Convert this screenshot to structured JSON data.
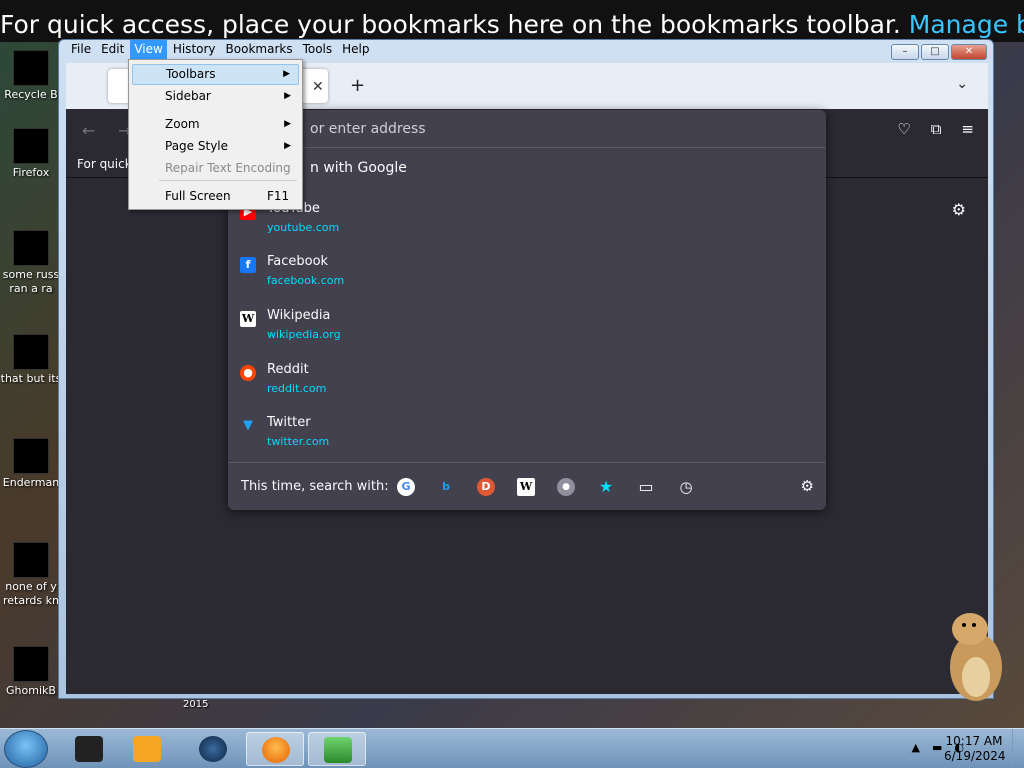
{
  "desktop": {
    "banner_text": "For quick access, place your bookmarks here on the bookmarks toolbar.",
    "banner_link": "Manage book",
    "icons": [
      {
        "label": "Recycle B"
      },
      {
        "label": "Firefox"
      },
      {
        "label": "some russ ran a ra"
      },
      {
        "label": "that but its"
      },
      {
        "label": "Enderman"
      },
      {
        "label": "none of y retards kn"
      },
      {
        "label": "GhomikB"
      }
    ],
    "year_label": "2015"
  },
  "window": {
    "menubar": [
      "File",
      "Edit",
      "View",
      "History",
      "Bookmarks",
      "Tools",
      "Help"
    ],
    "active_menu": "View",
    "controls": {
      "minimize": "–",
      "maximize": "□",
      "close": "✕"
    }
  },
  "tabs": {
    "new_tab": "+",
    "list_all": "⌄",
    "close": "✕"
  },
  "navbar": {
    "back": "←",
    "forward": "→"
  },
  "bookmarks_bar": {
    "text": "For quick"
  },
  "urlbar": {
    "placeholder": "or enter address",
    "search_with": "n with Google",
    "suggestions": [
      {
        "title": "YouTube",
        "url": "youtube.com",
        "icon": "youtube-icon",
        "icon_color": "#ff0000",
        "glyph": "▶"
      },
      {
        "title": "Facebook",
        "url": "facebook.com",
        "icon": "facebook-icon",
        "icon_color": "#1877f2",
        "glyph": "f"
      },
      {
        "title": "Wikipedia",
        "url": "wikipedia.org",
        "icon": "wikipedia-icon",
        "icon_color": "#ffffff",
        "glyph": "W"
      },
      {
        "title": "Reddit",
        "url": "reddit.com",
        "icon": "reddit-icon",
        "icon_color": "#ff4500",
        "glyph": "●"
      },
      {
        "title": "Twitter",
        "url": "twitter.com",
        "icon": "twitter-icon",
        "icon_color": "#1da1f2",
        "glyph": "🐦"
      }
    ],
    "this_time_label": "This time, search with:",
    "engines": [
      {
        "name": "google-icon",
        "color": "#ffffff",
        "glyph": "G"
      },
      {
        "name": "bing-icon",
        "color": "#2b2a33",
        "glyph": "b"
      },
      {
        "name": "duckduckgo-icon",
        "color": "#de5833",
        "glyph": "D"
      },
      {
        "name": "wikipedia-icon",
        "color": "#ffffff",
        "glyph": "W"
      },
      {
        "name": "search-icon",
        "color": "#8f8f9d",
        "glyph": "🔍"
      },
      {
        "name": "bookmarks-star-icon",
        "color": "#42414d",
        "glyph": "★"
      },
      {
        "name": "tabs-icon",
        "color": "#42414d",
        "glyph": "▭"
      },
      {
        "name": "history-icon",
        "color": "#42414d",
        "glyph": "◷"
      }
    ]
  },
  "view_menu": {
    "items": [
      {
        "label": "Toolbars",
        "submenu": true,
        "disabled": false
      },
      {
        "label": "Sidebar",
        "submenu": true,
        "disabled": false
      },
      {
        "label": "Zoom",
        "submenu": true,
        "disabled": false
      },
      {
        "label": "Page Style",
        "submenu": true,
        "disabled": false
      },
      {
        "label": "Repair Text Encoding",
        "submenu": false,
        "disabled": true
      },
      {
        "label": "Full Screen",
        "submenu": false,
        "disabled": false,
        "shortcut": "F11"
      }
    ]
  },
  "taskbar": {
    "clock_time": "10:17 AM",
    "clock_date": "6/19/2024"
  }
}
